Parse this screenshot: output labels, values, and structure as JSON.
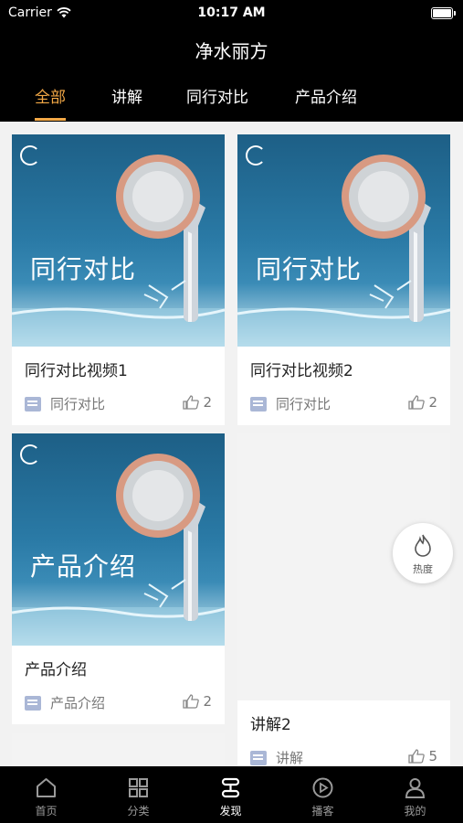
{
  "status_bar": {
    "carrier": "Carrier",
    "time": "10:17 AM"
  },
  "header": {
    "title": "净水丽方"
  },
  "tabs": [
    {
      "label": "全部",
      "active": true
    },
    {
      "label": "讲解",
      "active": false
    },
    {
      "label": "同行对比",
      "active": false
    },
    {
      "label": "产品介绍",
      "active": false
    }
  ],
  "cards": [
    {
      "thumb_text": "同行对比",
      "title": "同行对比视频1",
      "category": "同行对比",
      "likes": "2"
    },
    {
      "thumb_text": "同行对比",
      "title": "同行对比视频2",
      "category": "同行对比",
      "likes": "2"
    },
    {
      "thumb_text": "产品介绍",
      "title": "产品介绍",
      "category": "产品介绍",
      "likes": "2"
    },
    {
      "thumb_text": "",
      "title": "讲解2",
      "category": "讲解",
      "likes": "5"
    }
  ],
  "hot_button": {
    "label": "热度"
  },
  "bottom_nav": [
    {
      "label": "首页",
      "icon": "home-icon",
      "active": false
    },
    {
      "label": "分类",
      "icon": "grid-icon",
      "active": false
    },
    {
      "label": "发现",
      "icon": "discover-icon",
      "active": true
    },
    {
      "label": "播客",
      "icon": "play-icon",
      "active": false
    },
    {
      "label": "我的",
      "icon": "user-icon",
      "active": false
    }
  ],
  "colors": {
    "accent": "#f3a846",
    "header_bg": "#000000",
    "thumb_blue": "#1d5f86"
  }
}
